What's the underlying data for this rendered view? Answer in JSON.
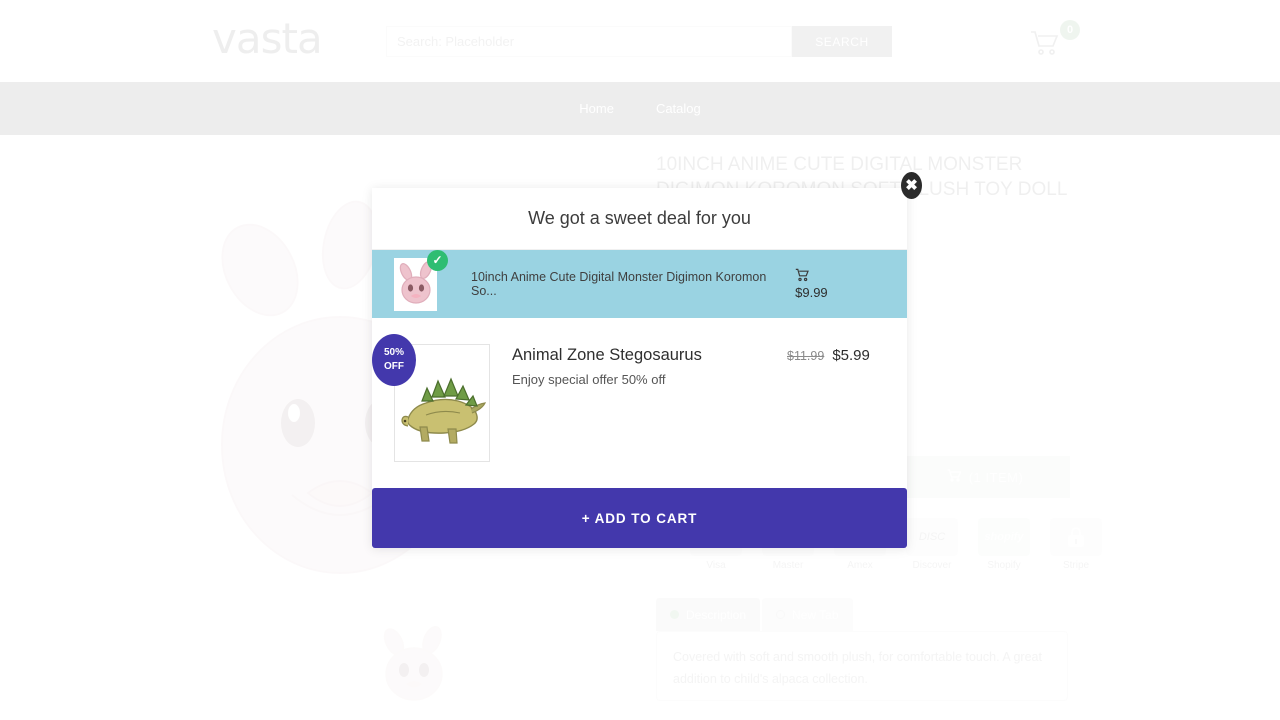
{
  "header": {
    "logo_text": "vasta",
    "search_placeholder": "Search: Placeholder",
    "search_value": "",
    "search_button_label": "SEARCH",
    "cart_icon": "shopping-cart-icon",
    "cart_count": "0",
    "cart_badge_color": "#3aa33a"
  },
  "nav": {
    "items": [
      {
        "label": "Home"
      },
      {
        "label": "Catalog"
      }
    ]
  },
  "product": {
    "title": "10INCH ANIME CUTE DIGITAL MONSTER DIGIMON KOROMON SOFT PLUSH TOY DOLL PILLOW",
    "add_to_cart_label": "(1 ITEM)",
    "add_to_cart_icon": "cart-icon",
    "payments": [
      {
        "label": "Visa",
        "glyph": "VISA"
      },
      {
        "label": "Master",
        "glyph": "MC"
      },
      {
        "label": "Amex",
        "glyph": "AMEX"
      },
      {
        "label": "Discover",
        "glyph": "DISC"
      },
      {
        "label": "Shopify",
        "glyph": "shopify"
      },
      {
        "label": "Stripe",
        "glyph": "stripe"
      }
    ],
    "tabs": [
      {
        "label": "Description",
        "active": true
      },
      {
        "label": "New Tab",
        "active": false
      }
    ],
    "description": "Covered with soft and smooth plush, for comfortable touch. A great addition to child's alpaca collection."
  },
  "modal": {
    "heading": "We got a sweet deal for you",
    "close_icon": "close-icon",
    "accent_color": "#4338ac",
    "selected_row_color": "#9ad3e2",
    "add_to_cart_label": "+ ADD TO CART",
    "offers": [
      {
        "selected": true,
        "check_icon": "check-icon",
        "cart_icon": "cart-icon",
        "title": "10inch Anime Cute Digital Monster Digimon Koromon So...",
        "price": "$9.99",
        "thumb": "plush-toy-thumbnail"
      },
      {
        "selected": false,
        "badge_line1": "50%",
        "badge_line2": "OFF",
        "title": "Animal Zone Stegosaurus",
        "subtitle": "Enjoy special offer 50% off",
        "price_old": "$11.99",
        "price_new": "$5.99",
        "thumb": "stegosaurus-toy-thumbnail"
      }
    ]
  }
}
